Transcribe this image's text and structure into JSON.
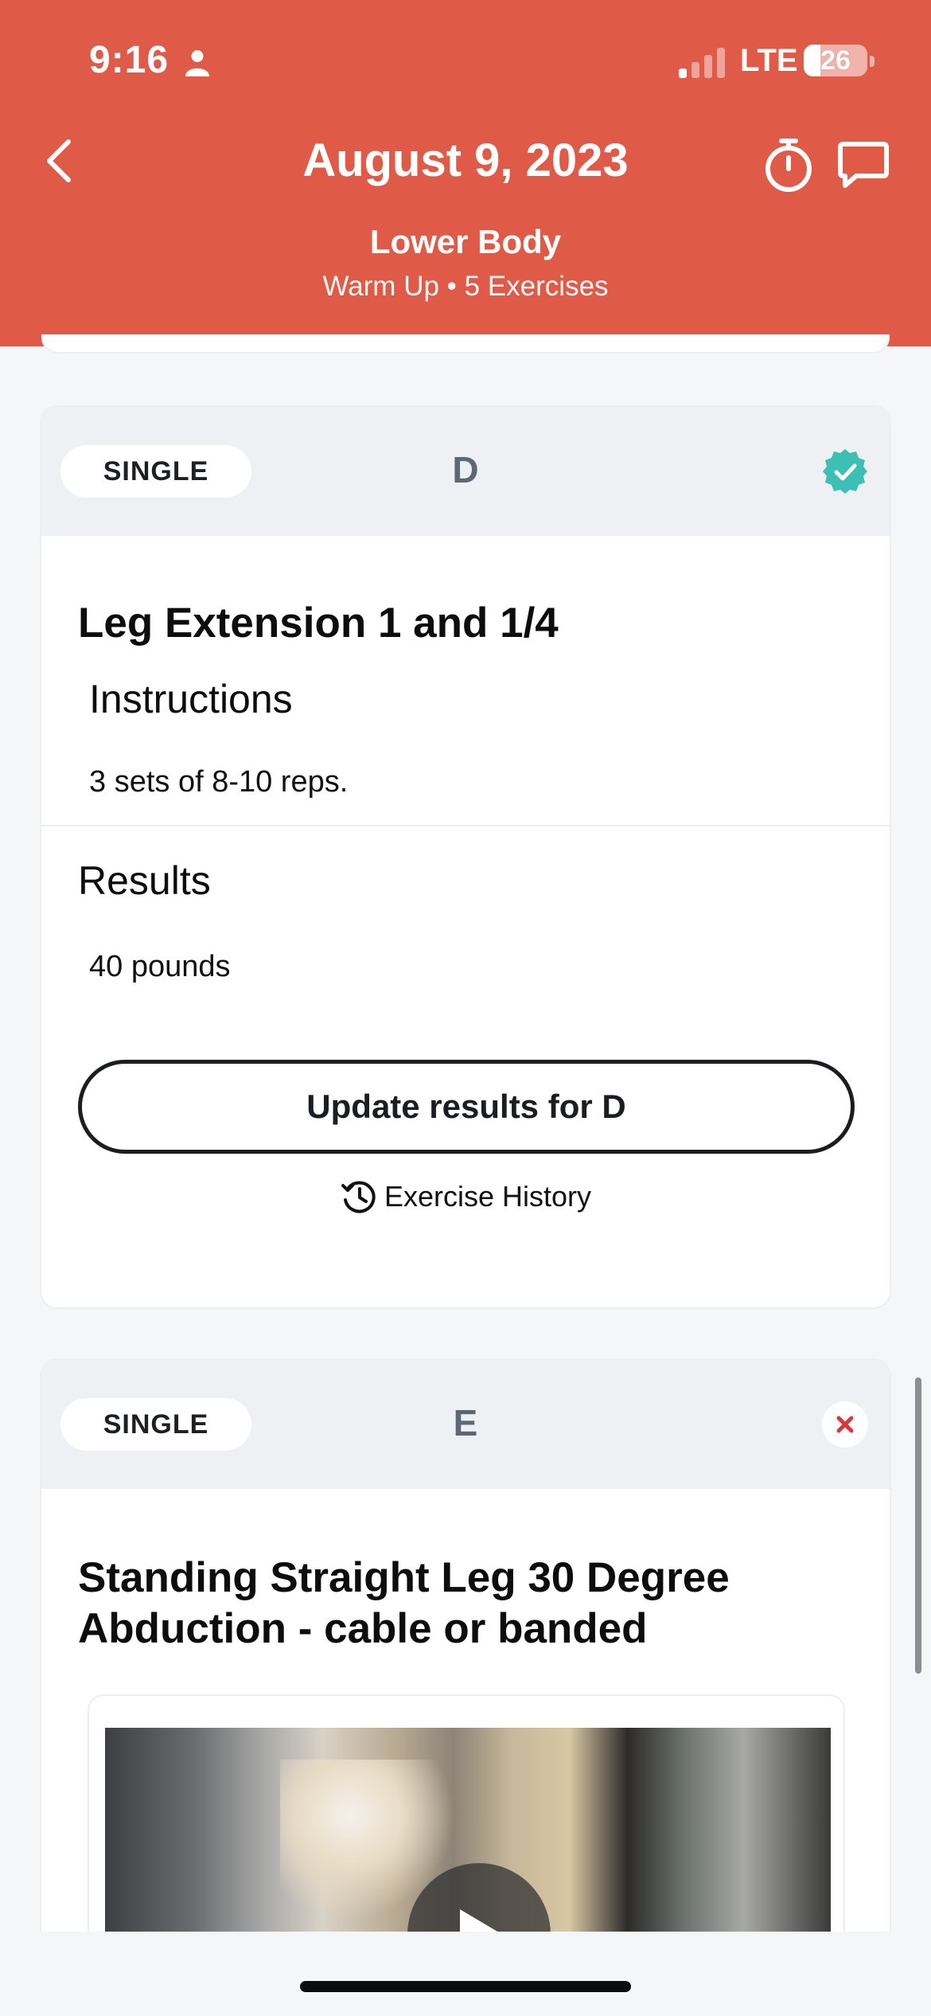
{
  "status_bar": {
    "time": "9:16",
    "network": "LTE",
    "battery": "26"
  },
  "header": {
    "title": "August 9, 2023",
    "subtitle": "Lower Body",
    "meta": "Warm Up • 5 Exercises",
    "background_color": "#e05a48",
    "icons": [
      "back-chevron-icon",
      "timer-icon",
      "chat-icon"
    ]
  },
  "exercises": [
    {
      "type": "SINGLE",
      "letter": "D",
      "status": "completed",
      "status_color": "#3dbfb3",
      "name": "Leg Extension 1 and 1/4",
      "instructions_heading": "Instructions",
      "instructions": "3 sets of 8-10 reps.",
      "results_heading": "Results",
      "result": "40 pounds",
      "update_button": "Update results for D",
      "history_link": "Exercise History"
    },
    {
      "type": "SINGLE",
      "letter": "E",
      "status": "not-completed",
      "status_color": "#d9363e",
      "name": "Standing Straight Leg 30 Degree Abduction - cable or banded",
      "has_video": true
    }
  ]
}
